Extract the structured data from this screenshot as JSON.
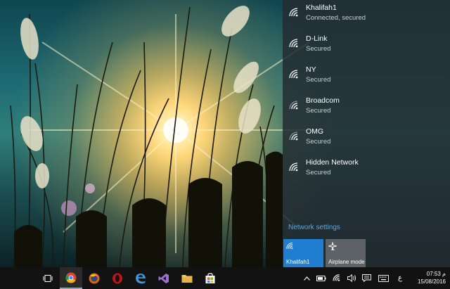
{
  "networks": [
    {
      "name": "Khalifah1",
      "status": "Connected, secured"
    },
    {
      "name": "D-Link",
      "status": "Secured"
    },
    {
      "name": "NY",
      "status": "Secured"
    },
    {
      "name": "Broadcom",
      "status": "Secured"
    },
    {
      "name": "OMG",
      "status": "Secured"
    },
    {
      "name": "Hidden Network",
      "status": "Secured"
    }
  ],
  "network_settings_label": "Network settings",
  "quick_actions": {
    "wifi_label": "Khalifah1",
    "airplane_label": "Airplane mode"
  },
  "taskbar": {
    "apps": [
      "task-view",
      "chrome",
      "firefox",
      "opera",
      "edge",
      "visual-studio",
      "file-explorer",
      "store"
    ]
  },
  "tray": {
    "language": "ع",
    "time": "07:53 م",
    "date": "15/08/2016"
  },
  "colors": {
    "flyout_bg": "#242c32",
    "accent": "#1f7ed1",
    "link": "#5aa7e6",
    "taskbar": "#121212"
  }
}
